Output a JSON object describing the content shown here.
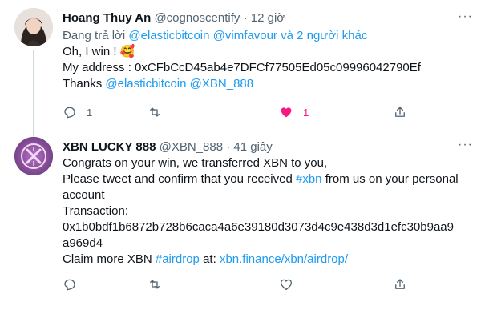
{
  "tweet1": {
    "name": "Hoang Thuy An",
    "handle": "@cognoscentify",
    "dot": "·",
    "time": "12 giờ",
    "replying_prefix": "Đang trả lời",
    "replying_user1": "@elasticbitcoin",
    "replying_user2": "@vimfavour",
    "replying_suffix": "và 2 người khác",
    "line1": "Oh, I win ! 🥰",
    "line2": "My address : 0xCFbCcD45ab4e7DFCf77505Ed05c09996042790Ef",
    "line3_prefix": "Thanks",
    "line3_mention1": "@elasticbitcoin",
    "line3_mention2": "@XBN_888",
    "reply_count": "1",
    "like_count": "1",
    "more_label": "···"
  },
  "tweet2": {
    "name": "XBN LUCKY 888",
    "handle": "@XBN_888",
    "dot": "·",
    "time": "41 giây",
    "line1": "Congrats on your win, we transferred XBN to you,",
    "line2_prefix": "Please tweet and confirm that you received",
    "line2_hashtag": "#xbn",
    "line2_suffix": "from us on your personal",
    "line3": "account",
    "line4": "Transaction:",
    "line5": "0x1b0bdf1b6872b728b6caca4a6e39180d3073d4c9e438d3d1efc30b9aa9",
    "line6": "a969d4",
    "line7_prefix": "Claim more XBN",
    "line7_hashtag": "#airdrop",
    "line7_middle": "at:",
    "line7_link": "xbn.finance/xbn/airdrop/",
    "more_label": "···"
  },
  "colors": {
    "link": "#1d9bf0",
    "like": "#f91880",
    "secondary": "#536471"
  },
  "icons": {
    "reply": "reply-icon",
    "retweet": "retweet-icon",
    "like": "heart-icon",
    "share": "share-icon"
  }
}
